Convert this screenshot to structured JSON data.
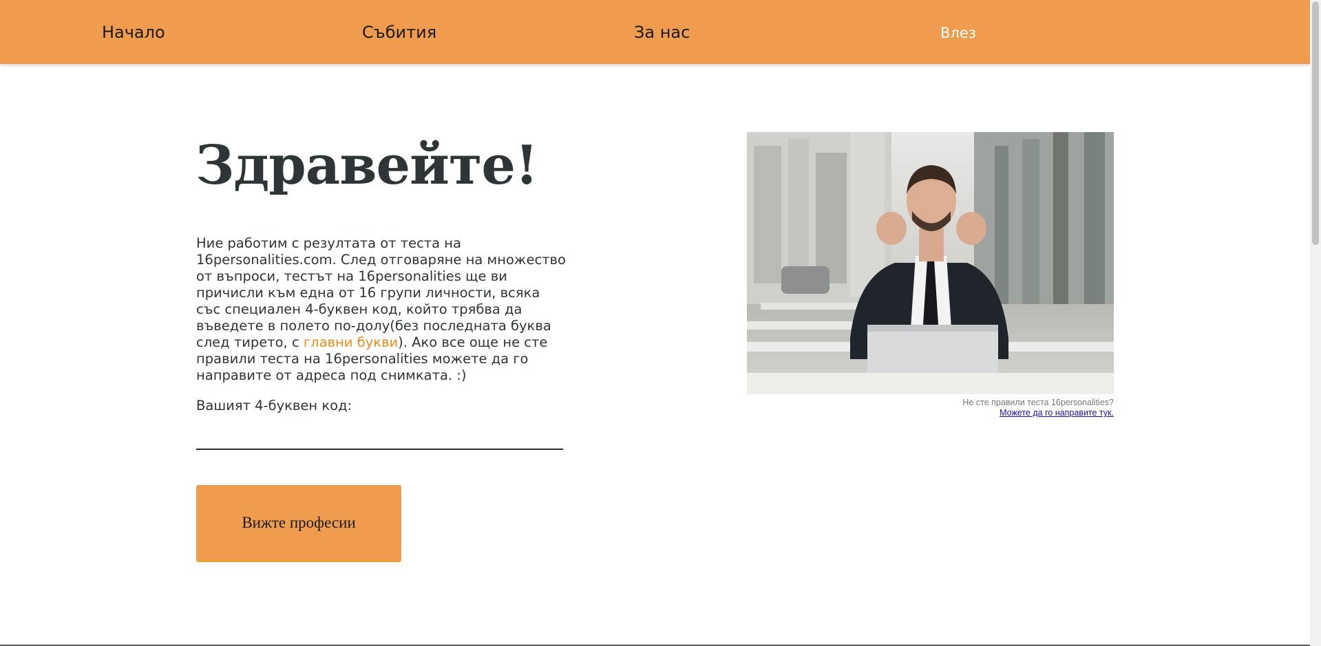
{
  "nav": {
    "home": "Начало",
    "events": "Събития",
    "about": "За нас",
    "login": "Влез"
  },
  "hero": {
    "title": "Здравейте!",
    "intro_before": "Ние работим с резултата от теста на 16personalities.com. След отговаряне на множество от въпроси, тестът на 16personalities ще ви причисли към една от 16 групи личности, всяка със специален 4-буквен код, който трябва да въведете в полето по-долу(без последната буква след тирето, с ",
    "intro_highlight": "главни букви",
    "intro_after": "). Ако все още не сте правили теста на 16personalities можете да го направите от адреса под снимката. :)",
    "code_label": "Вашият 4-буквен код:",
    "code_value": "",
    "button_label": "Вижте професии"
  },
  "photo": {
    "caption_line1": "Не сте правили теста 16personalities?",
    "caption_link": "Можете да го направите тук."
  },
  "colors": {
    "nav_bg": "#f09c4f",
    "accent_text": "#f08a1a",
    "button_bg": "#f09c4f"
  }
}
